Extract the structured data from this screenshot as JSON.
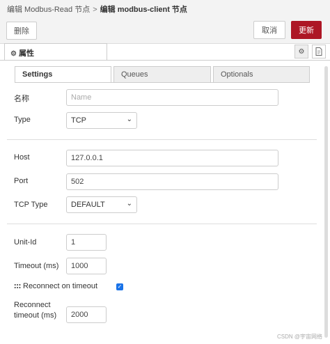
{
  "breadcrumb": {
    "parent": "编辑 Modbus-Read 节点",
    "separator": ">",
    "current": "编辑 modbus-client 节点"
  },
  "toolbar": {
    "delete_label": "删除",
    "cancel_label": "取消",
    "update_label": "更新",
    "update_color": "#ad1625"
  },
  "panel": {
    "props_tab_label": "属性",
    "props_tab_icon": "gear-icon",
    "side_icons": [
      "gear-icon",
      "document-icon"
    ]
  },
  "subtabs": [
    {
      "label": "Settings",
      "active": true
    },
    {
      "label": "Queues",
      "active": false
    },
    {
      "label": "Optionals",
      "active": false
    }
  ],
  "form": {
    "name_label": "名称",
    "name_placeholder": "Name",
    "name_value": "",
    "type_label": "Type",
    "type_value": "TCP",
    "host_label": "Host",
    "host_value": "127.0.0.1",
    "port_label": "Port",
    "port_value": "502",
    "tcp_type_label": "TCP Type",
    "tcp_type_value": "DEFAULT",
    "unit_id_label": "Unit-Id",
    "unit_id_value": "1",
    "timeout_label": "Timeout (ms)",
    "timeout_value": "1000",
    "reconnect_label": "Reconnect on timeout",
    "reconnect_checked": true,
    "reconnect_timeout_label_1": "Reconnect",
    "reconnect_timeout_label_2": "timeout (ms)",
    "reconnect_timeout_value": "2000"
  },
  "watermark": "CSDN @宇宙网络"
}
